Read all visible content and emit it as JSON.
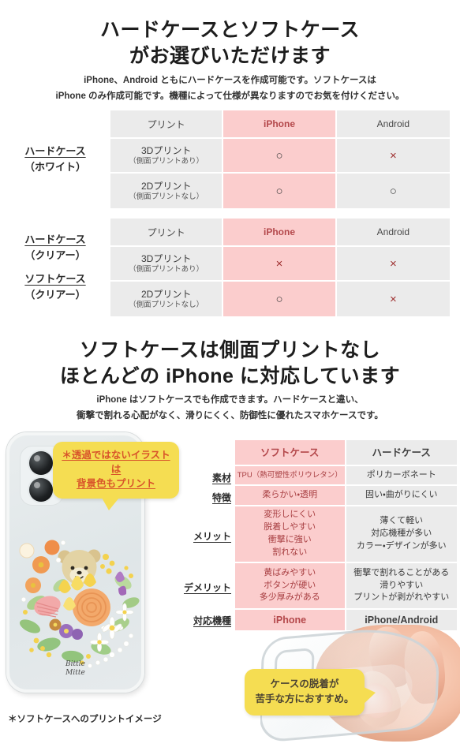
{
  "section1": {
    "heading_line1": "ハードケースとソフトケース",
    "heading_line2": "がお選びいただけます",
    "lead_line1": "iPhone、Android ともにハードケースを作成可能です。ソフトケースは",
    "lead_line2": "iPhone のみ作成可能です。機種によって仕様が異なりますのでお気を付けください。"
  },
  "table1": {
    "row_label_main": "ハードケース",
    "row_label_sub": "（ホワイト）",
    "headers": [
      "プリント",
      "iPhone",
      "Android"
    ],
    "rows": [
      {
        "name_main": "3Dプリント",
        "name_sub": "（側面プリントあり）",
        "iphone": "○",
        "android": "×"
      },
      {
        "name_main": "2Dプリント",
        "name_sub": "（側面プリントなし）",
        "iphone": "○",
        "android": "○"
      }
    ]
  },
  "table2": {
    "row_label_main_a": "ハードケース",
    "row_label_sub_a": "（クリアー）",
    "row_label_main_b": "ソフトケース",
    "row_label_sub_b": "（クリアー）",
    "headers": [
      "プリント",
      "iPhone",
      "Android"
    ],
    "rows": [
      {
        "name_main": "3Dプリント",
        "name_sub": "（側面プリントあり）",
        "iphone": "×",
        "android": "×"
      },
      {
        "name_main": "2Dプリント",
        "name_sub": "（側面プリントなし）",
        "iphone": "○",
        "android": "×"
      }
    ]
  },
  "section2": {
    "heading_line1": "ソフトケースは側面プリントなし",
    "heading_line2": "ほとんどの iPhone に対応しています",
    "lead_line1": "iPhone はソフトケースでも作成できます。ハードケースと違い、",
    "lead_line2": "衝撃で割れる心配がなく、滑りにくく、防御性に優れたスマホケースです。"
  },
  "spec_table": {
    "headers": [
      "ソフトケース",
      "ハードケース"
    ],
    "row_labels": [
      "素材",
      "特徴",
      "メリット",
      "デメリット",
      "対応機種"
    ],
    "rows": [
      {
        "label": "素材",
        "soft": "TPU（熱可塑性ポリウレタン）",
        "hard": "ポリカーボネート"
      },
      {
        "label": "特徴",
        "soft": "柔らかい・透明",
        "hard": "固い・曲がりにくい"
      },
      {
        "label": "メリット",
        "soft": "変形しにくい\n脱着しやすい\n衝撃に強い\n割れない",
        "hard": "薄くて軽い\n対応機種が多い\nカラー・デザインが多い"
      },
      {
        "label": "デメリット",
        "soft": "黄ばみやすい\nボタンが硬い\n多少厚みがある",
        "hard": "衝撃で割れることがある\n滑りやすい\nプリントが剥がれやすい"
      },
      {
        "label": "対応機種",
        "soft": "iPhone",
        "hard": "iPhone/Android"
      }
    ]
  },
  "callouts": {
    "yellow_top_line1": "＊透過ではないイラストは",
    "yellow_top_line2": "背景色もプリント",
    "yellow_bottom_line1": "ケースの脱着が",
    "yellow_bottom_line2": "苦手な方におすすめ。"
  },
  "phone": {
    "brand_line1": "Bittle",
    "brand_line2": "Mitte"
  },
  "footnote": "＊ソフトケースへのプリントイメージ",
  "colors": {
    "pink_cell": "#fbcdcd",
    "gray_cell": "#ebebeb",
    "pink_text": "#b4484b",
    "yellow_callout": "#f5dd52",
    "orange_text": "#d8542a",
    "mark_x": "#9e2f2f"
  }
}
